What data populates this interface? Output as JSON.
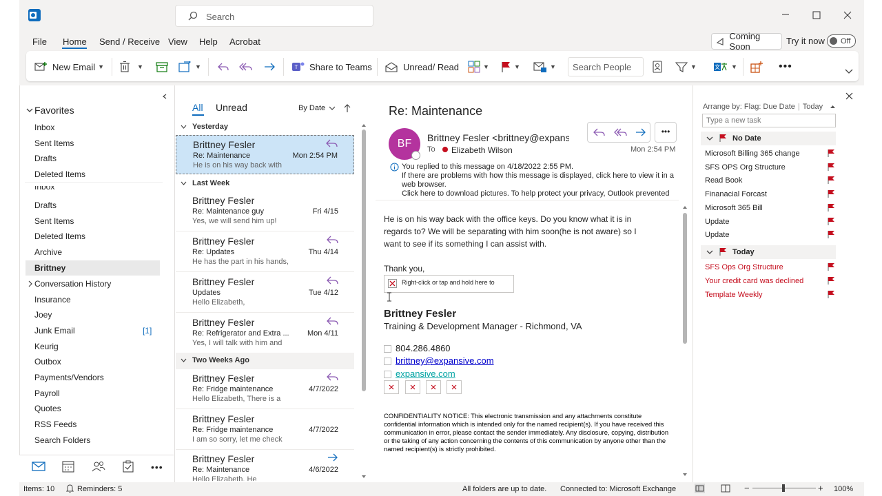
{
  "title_bar": {
    "search_placeholder": "Search"
  },
  "menu": [
    "File",
    "Home",
    "Send / Receive",
    "View",
    "Help",
    "Acrobat"
  ],
  "coming_soon": "Coming Soon",
  "try_it": "Try it now",
  "toggle_label": "Off",
  "ribbon": {
    "new_email": "New Email",
    "share_to_teams": "Share to Teams",
    "unread_read": "Unread/ Read",
    "search_people_placeholder": "Search People"
  },
  "favorites": {
    "header": "Favorites",
    "items": [
      "Inbox",
      "Sent Items",
      "Drafts",
      "Deleted Items"
    ]
  },
  "folders": [
    {
      "label": "Inbox"
    },
    {
      "label": "Drafts"
    },
    {
      "label": "Sent Items"
    },
    {
      "label": "Deleted Items"
    },
    {
      "label": "Archive"
    },
    {
      "label": "Brittney"
    },
    {
      "label": "Conversation History"
    },
    {
      "label": "Insurance"
    },
    {
      "label": "Joey"
    },
    {
      "label": "Junk Email",
      "count": "[1]"
    },
    {
      "label": "Keurig"
    },
    {
      "label": "Outbox"
    },
    {
      "label": "Payments/Vendors"
    },
    {
      "label": "Payroll"
    },
    {
      "label": "Quotes"
    },
    {
      "label": "RSS Feeds"
    },
    {
      "label": "Search Folders"
    }
  ],
  "list_header": {
    "all": "All",
    "unread": "Unread",
    "sort": "By Date"
  },
  "groups": {
    "yesterday": "Yesterday",
    "last_week": "Last Week",
    "two_weeks": "Two Weeks Ago"
  },
  "messages": [
    {
      "from": "Brittney Fesler",
      "subject": "Re: Maintenance",
      "preview": "He is on his way back with",
      "date": "Mon 2:54 PM",
      "icon": "reply-icon"
    },
    {
      "from": "Brittney Fesler",
      "subject": "Re: Maintenance guy",
      "preview": "Yes, we will send him up!",
      "date": "Fri 4/15",
      "icon": ""
    },
    {
      "from": "Brittney Fesler",
      "subject": "Re: Updates",
      "preview": "He has the part in his hands,",
      "date": "Thu 4/14",
      "icon": "reply-icon"
    },
    {
      "from": "Brittney Fesler",
      "subject": "Updates",
      "preview": "Hello Elizabeth,",
      "date": "Tue 4/12",
      "icon": "reply-icon"
    },
    {
      "from": "Brittney Fesler",
      "subject": "Re: Refrigerator and Extra ...",
      "preview": "Yes, I will talk with him and",
      "date": "Mon 4/11",
      "icon": "reply-icon"
    },
    {
      "from": "Brittney Fesler",
      "subject": "Re: Fridge maintenance",
      "preview": "Hello Elizabeth,  There is a",
      "date": "4/7/2022",
      "icon": "reply-icon"
    },
    {
      "from": "Brittney Fesler",
      "subject": "Re: Fridge maintenance",
      "preview": "I am so sorry, let me check",
      "date": "4/7/2022",
      "icon": ""
    },
    {
      "from": "Brittney Fesler",
      "subject": "Re: Maintenance",
      "preview": "Hello Elizabeth,  He",
      "date": "4/6/2022",
      "icon": "forward-icon"
    }
  ],
  "reading": {
    "subject": "Re: Maintenance",
    "avatar": "BF",
    "sender": "Brittney Fesler <brittney@expans",
    "to_label": "To",
    "to_name": "Elizabeth Wilson",
    "date": "Mon 2:54 PM",
    "info1": "You replied to this message on 4/18/2022 2:55 PM.",
    "info2": "If there are problems with how this message is displayed, click here to view it in a",
    "info3": "web browser.",
    "info4": "Click here to download pictures. To help protect your privacy, Outlook prevented",
    "body1": "He is on his way back with the office keys. Do you know what it is in",
    "body2": "regards to? We will be separating with him soon(he is not aware) so I",
    "body3": "want to see if its something I can assist with.",
    "thanks": "Thank you,",
    "img_placeholder": "Right-click or tap and hold here to",
    "sig_name": "Brittney Fesler",
    "sig_title": "Training & Development Manager - Richmond, VA",
    "phone": "804.286.4860",
    "email": "brittney@expansive.com",
    "website": "expansive.com",
    "confidential": "CONFIDENTIALITY NOTICE: This electronic transmission and any attachments constitute confidential information which is intended only for the named recipient(s). If you have received this communication in error, please contact the sender immediately. Any disclosure, copying, distribution or the taking of any action concerning the contents of this communication by anyone other than the named recipient(s) is strictly prohibited."
  },
  "todo": {
    "arrange": "Arrange by: Flag: Due Date",
    "today_label": "Today",
    "new_task_placeholder": "Type a new task",
    "no_date": "No Date",
    "no_date_tasks": [
      "Microsoft Billing 365 change",
      "SFS OPS Org Structure",
      "Read Book",
      "Finanacial Forcast",
      "Microsoft 365 Bill",
      "Update",
      "Update"
    ],
    "today": "Today",
    "today_tasks": [
      "SFS Ops Org Structure",
      "Your credit card was declined",
      "Template Weekly"
    ]
  },
  "status": {
    "items": "Items: 10",
    "reminders": "Reminders: 5",
    "uptodate": "All folders are up to date.",
    "connected": "Connected to: Microsoft Exchange",
    "zoom": "100%"
  },
  "colors": {
    "accent": "#0f6cbd",
    "selected": "#cce4f7",
    "flag": "#c50f1f",
    "avatar": "#b4339e",
    "reply": "#8c5bb3"
  }
}
